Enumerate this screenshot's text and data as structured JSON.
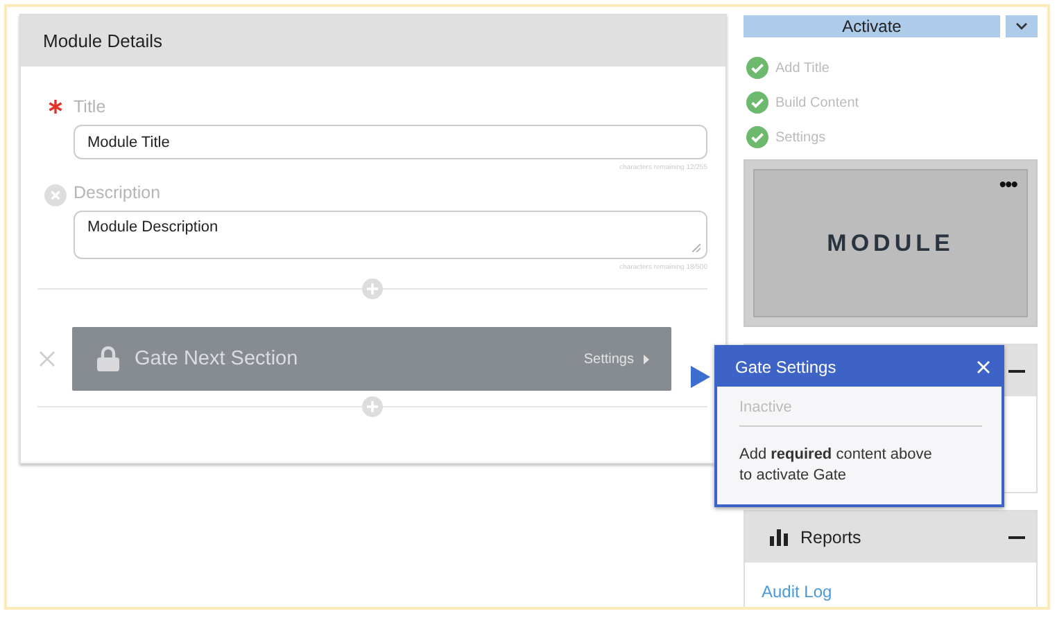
{
  "module_details": {
    "title": "Module Details",
    "fields": [
      {
        "label": "Title",
        "required": true,
        "value": "Module Title",
        "counter": "characters remaining 12/255",
        "multiline": false
      },
      {
        "label": "Description",
        "required": false,
        "value": "Module Description",
        "counter": "characters remaining 18/500",
        "multiline": true
      }
    ],
    "gate": {
      "title": "Gate Next Section",
      "settings_link": "Settings"
    }
  },
  "activate_button": "Activate",
  "checklist": [
    {
      "label": "Add Title",
      "checked": true
    },
    {
      "label": "Build Content",
      "checked": true
    },
    {
      "label": "Settings",
      "checked": true
    }
  ],
  "thumbnail": {
    "label": "MODULE",
    "menu": "•••"
  },
  "reports_panel": {
    "title": "Reports",
    "links": [
      "Audit Log"
    ]
  },
  "gate_settings_popover": {
    "title": "Gate Settings",
    "status": "Inactive",
    "message": "Add **required** content above\nto activate Gate"
  }
}
